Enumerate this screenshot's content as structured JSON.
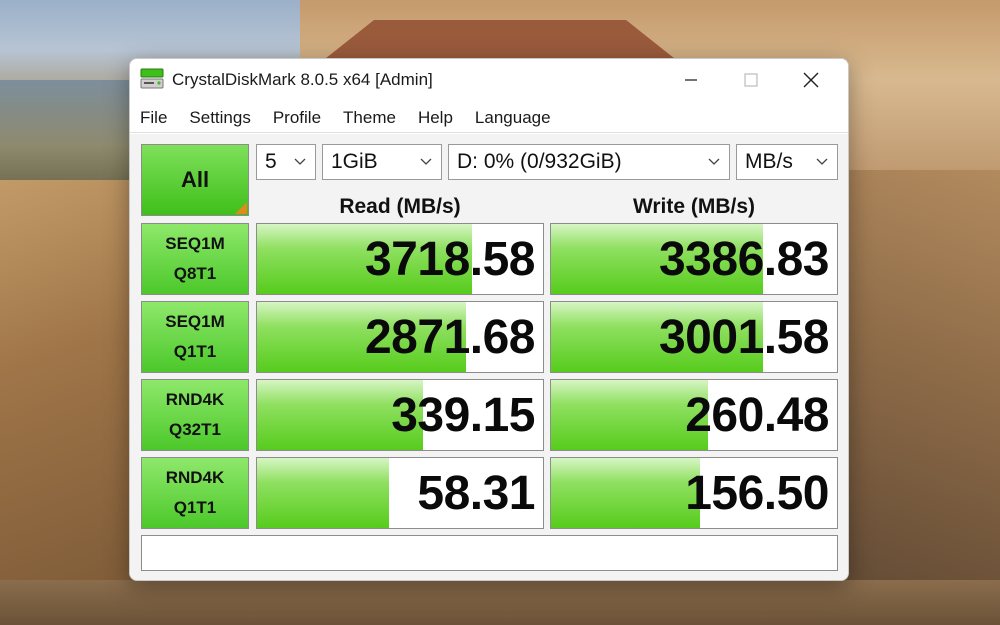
{
  "window": {
    "title": "CrystalDiskMark 8.0.5 x64 [Admin]"
  },
  "menu": [
    "File",
    "Settings",
    "Profile",
    "Theme",
    "Help",
    "Language"
  ],
  "controls": {
    "all_label": "All",
    "count": "5",
    "size": "1GiB",
    "drive": "D: 0% (0/932GiB)",
    "unit": "MB/s"
  },
  "headers": {
    "read": "Read (MB/s)",
    "write": "Write (MB/s)"
  },
  "tests": [
    {
      "line1": "SEQ1M",
      "line2": "Q8T1",
      "read": "3718.58",
      "write": "3386.83",
      "read_fill": 0.75,
      "write_fill": 0.74
    },
    {
      "line1": "SEQ1M",
      "line2": "Q1T1",
      "read": "2871.68",
      "write": "3001.58",
      "read_fill": 0.73,
      "write_fill": 0.74
    },
    {
      "line1": "RND4K",
      "line2": "Q32T1",
      "read": "339.15",
      "write": "260.48",
      "read_fill": 0.58,
      "write_fill": 0.55
    },
    {
      "line1": "RND4K",
      "line2": "Q1T1",
      "read": "58.31",
      "write": "156.50",
      "read_fill": 0.46,
      "write_fill": 0.52
    }
  ],
  "comment": "",
  "colors": {
    "accent_green": "#56cc1c",
    "corner_orange": "#e08a1e"
  }
}
